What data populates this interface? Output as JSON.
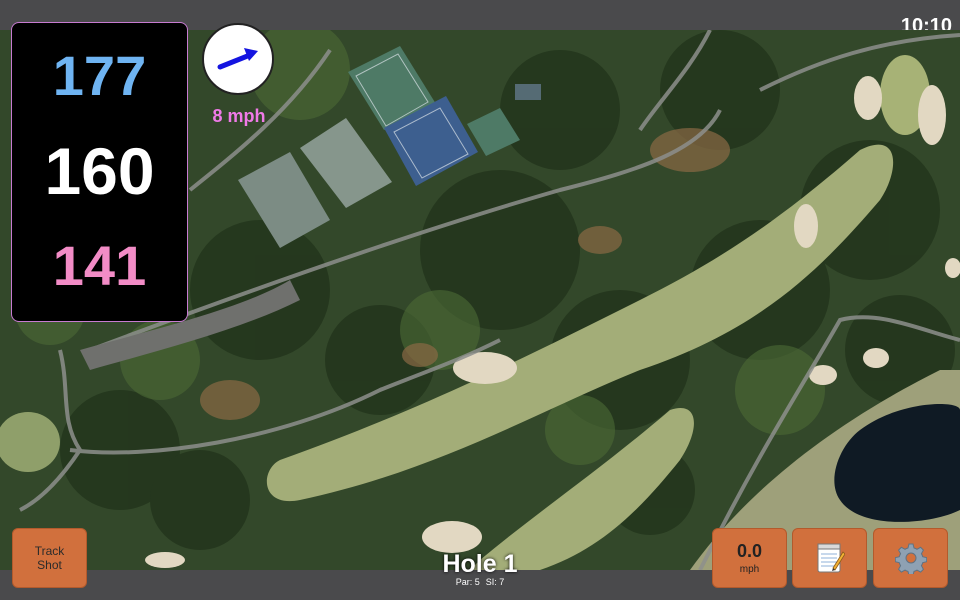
{
  "status": {
    "clock": "10:10"
  },
  "distances": {
    "back": "177",
    "middle": "160",
    "front": "141",
    "colors": {
      "back": "#6fb4f2",
      "middle": "#ffffff",
      "front": "#f28cc6"
    }
  },
  "wind": {
    "speed_label": "8 mph",
    "label_color": "#f07ae8",
    "arrow_color": "#1414e0",
    "arrow_icon": "wind-direction-arrow-icon"
  },
  "buttons": {
    "track_shot_line1": "Track",
    "track_shot_line2": "Shot",
    "wind_value": "0.0",
    "wind_unit": "mph",
    "notes_icon": "notepad-icon",
    "settings_icon": "gear-icon",
    "accent": "#d1703d"
  },
  "hole": {
    "title": "Hole 1",
    "par": "Par: 5",
    "si": "SI: 7"
  }
}
